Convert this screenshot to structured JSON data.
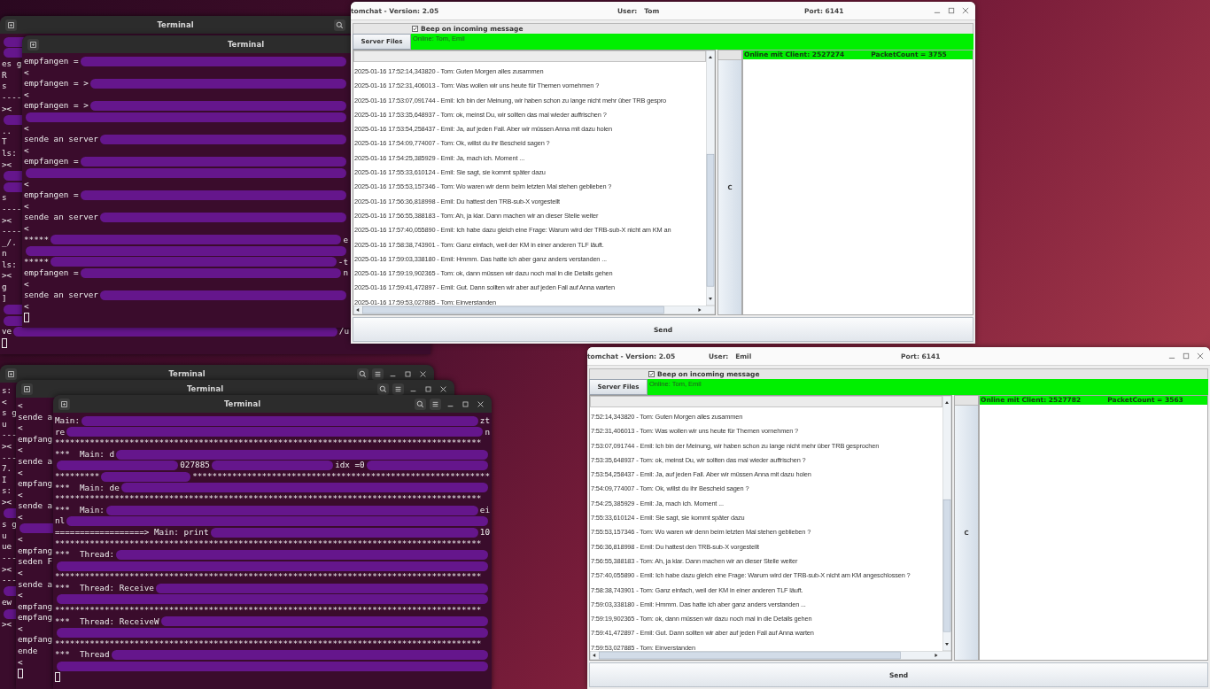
{
  "terminals": [
    {
      "title": "Terminal",
      "cursor": true,
      "lines": [
        {
          "parts": [
            {
              "kind": "scribble"
            }
          ]
        },
        {
          "parts": [
            {
              "kind": "scribble"
            }
          ]
        },
        {
          "parts": [
            {
              "kind": "text",
              "text": "es g"
            }
          ]
        },
        {
          "parts": [
            {
              "kind": "text",
              "text": "R"
            }
          ]
        },
        {
          "parts": [
            {
              "kind": "text",
              "text": "s"
            }
          ]
        },
        {
          "parts": [
            {
              "kind": "text",
              "text": "----"
            }
          ]
        },
        {
          "parts": [
            {
              "kind": "text",
              "text": "><"
            }
          ]
        },
        {
          "parts": [
            {
              "kind": "scribble"
            }
          ]
        },
        {
          "parts": [
            {
              "kind": "text",
              "text": ".."
            }
          ]
        },
        {
          "parts": [
            {
              "kind": "text",
              "text": "T"
            }
          ]
        },
        {
          "parts": [
            {
              "kind": "text",
              "text": "ls:"
            }
          ]
        },
        {
          "parts": [
            {
              "kind": "text",
              "text": "><"
            }
          ]
        },
        {
          "parts": [
            {
              "kind": "scribble"
            }
          ]
        },
        {
          "parts": [
            {
              "kind": "scribble"
            }
          ]
        },
        {
          "parts": [
            {
              "kind": "text",
              "text": "s"
            }
          ]
        },
        {
          "parts": [
            {
              "kind": "text",
              "text": "----"
            }
          ]
        },
        {
          "parts": [
            {
              "kind": "text",
              "text": "><"
            }
          ]
        },
        {
          "parts": [
            {
              "kind": "text",
              "text": "----"
            }
          ]
        },
        {
          "parts": [
            {
              "kind": "text",
              "text": "_/."
            }
          ]
        },
        {
          "parts": [
            {
              "kind": "text",
              "text": "n"
            }
          ]
        },
        {
          "parts": [
            {
              "kind": "text",
              "text": "ls:"
            }
          ]
        },
        {
          "parts": [
            {
              "kind": "text",
              "text": "><"
            }
          ]
        },
        {
          "parts": [
            {
              "kind": "text",
              "text": "g"
            }
          ]
        },
        {
          "parts": [
            {
              "kind": "text",
              "text": "]"
            }
          ]
        },
        {
          "parts": [
            {
              "kind": "scribble"
            }
          ]
        },
        {
          "parts": [
            {
              "kind": "scribble"
            }
          ]
        },
        {
          "parts": [
            {
              "kind": "text",
              "text": "ve"
            },
            {
              "kind": "scribble"
            },
            {
              "kind": "text",
              "text": "/u"
            }
          ]
        }
      ]
    },
    {
      "title": "Terminal",
      "cursor": true,
      "lines": [
        {
          "parts": [
            {
              "kind": "text",
              "text": "empfangen ="
            },
            {
              "kind": "scribble"
            }
          ]
        },
        {
          "parts": [
            {
              "kind": "text",
              "text": "<"
            }
          ]
        },
        {
          "parts": [
            {
              "kind": "text",
              "text": "empfangen = >"
            },
            {
              "kind": "scribble"
            }
          ]
        },
        {
          "parts": [
            {
              "kind": "text",
              "text": "<"
            }
          ]
        },
        {
          "parts": [
            {
              "kind": "text",
              "text": "empfangen = >"
            },
            {
              "kind": "scribble"
            }
          ]
        },
        {
          "parts": [
            {
              "kind": "scribble"
            }
          ]
        },
        {
          "parts": [
            {
              "kind": "text",
              "text": "<"
            }
          ]
        },
        {
          "parts": [
            {
              "kind": "text",
              "text": "sende an server"
            },
            {
              "kind": "scribble"
            }
          ]
        },
        {
          "parts": [
            {
              "kind": "text",
              "text": "<"
            }
          ]
        },
        {
          "parts": [
            {
              "kind": "text",
              "text": "empfangen ="
            },
            {
              "kind": "scribble"
            }
          ]
        },
        {
          "parts": [
            {
              "kind": "scribble"
            }
          ]
        },
        {
          "parts": [
            {
              "kind": "text",
              "text": "<"
            }
          ]
        },
        {
          "parts": [
            {
              "kind": "text",
              "text": "empfangen ="
            },
            {
              "kind": "scribble"
            }
          ]
        },
        {
          "parts": [
            {
              "kind": "text",
              "text": "<"
            }
          ]
        },
        {
          "parts": [
            {
              "kind": "text",
              "text": "sende an server"
            },
            {
              "kind": "scribble"
            }
          ]
        },
        {
          "parts": [
            {
              "kind": "text",
              "text": "<"
            }
          ]
        },
        {
          "parts": [
            {
              "kind": "text",
              "text": "*****"
            },
            {
              "kind": "scribble"
            },
            {
              "kind": "text",
              "text": "e"
            }
          ]
        },
        {
          "parts": [
            {
              "kind": "scribble"
            }
          ]
        },
        {
          "parts": [
            {
              "kind": "text",
              "text": "*****"
            },
            {
              "kind": "scribble"
            },
            {
              "kind": "text",
              "text": "-t"
            }
          ]
        },
        {
          "parts": [
            {
              "kind": "text",
              "text": "empfangen ="
            },
            {
              "kind": "scribble"
            },
            {
              "kind": "text",
              "text": "n"
            }
          ]
        },
        {
          "parts": [
            {
              "kind": "text",
              "text": "<"
            }
          ]
        },
        {
          "parts": [
            {
              "kind": "text",
              "text": "sende an server"
            },
            {
              "kind": "scribble"
            }
          ]
        },
        {
          "parts": [
            {
              "kind": "text",
              "text": "<"
            }
          ]
        }
      ]
    },
    {
      "title": "Terminal",
      "cursor": false,
      "lines": [
        {
          "parts": [
            {
              "kind": "text",
              "text": "s:"
            }
          ]
        },
        {
          "parts": [
            {
              "kind": "text",
              "text": "<"
            }
          ]
        },
        {
          "parts": [
            {
              "kind": "text",
              "text": "s g"
            }
          ]
        },
        {
          "parts": [
            {
              "kind": "text",
              "text": "u"
            }
          ]
        },
        {
          "parts": [
            {
              "kind": "text",
              "text": "---"
            }
          ]
        },
        {
          "parts": [
            {
              "kind": "text",
              "text": "><"
            }
          ]
        },
        {
          "parts": [
            {
              "kind": "text",
              "text": "---"
            }
          ]
        },
        {
          "parts": [
            {
              "kind": "text",
              "text": "7."
            }
          ]
        },
        {
          "parts": [
            {
              "kind": "text",
              "text": "I"
            }
          ]
        },
        {
          "parts": [
            {
              "kind": "text",
              "text": "s:"
            }
          ]
        },
        {
          "parts": [
            {
              "kind": "text",
              "text": "><"
            }
          ]
        },
        {
          "parts": [
            {
              "kind": "scribble"
            }
          ]
        },
        {
          "parts": [
            {
              "kind": "text",
              "text": "s g"
            }
          ]
        },
        {
          "parts": [
            {
              "kind": "text",
              "text": "u"
            }
          ]
        },
        {
          "parts": [
            {
              "kind": "text",
              "text": "ue"
            }
          ]
        },
        {
          "parts": [
            {
              "kind": "text",
              "text": "---"
            }
          ]
        },
        {
          "parts": [
            {
              "kind": "text",
              "text": "><"
            }
          ]
        },
        {
          "parts": [
            {
              "kind": "text",
              "text": "---"
            }
          ]
        },
        {
          "parts": [
            {
              "kind": "scribble"
            }
          ]
        },
        {
          "parts": [
            {
              "kind": "text",
              "text": "ew"
            }
          ]
        },
        {
          "parts": [
            {
              "kind": "scribble"
            }
          ]
        },
        {
          "parts": [
            {
              "kind": "text",
              "text": "><"
            }
          ]
        }
      ]
    },
    {
      "title": "Terminal",
      "cursor": true,
      "lines": [
        {
          "parts": [
            {
              "kind": "text",
              "text": "<"
            }
          ]
        },
        {
          "parts": [
            {
              "kind": "text",
              "text": "sende a"
            }
          ]
        },
        {
          "parts": [
            {
              "kind": "text",
              "text": "<"
            }
          ]
        },
        {
          "parts": [
            {
              "kind": "text",
              "text": "empfang"
            }
          ]
        },
        {
          "parts": [
            {
              "kind": "text",
              "text": "<"
            }
          ]
        },
        {
          "parts": [
            {
              "kind": "text",
              "text": "sende a"
            }
          ]
        },
        {
          "parts": [
            {
              "kind": "text",
              "text": "<"
            }
          ]
        },
        {
          "parts": [
            {
              "kind": "text",
              "text": "empfang"
            }
          ]
        },
        {
          "parts": [
            {
              "kind": "text",
              "text": "<"
            }
          ]
        },
        {
          "parts": [
            {
              "kind": "text",
              "text": "sende a"
            }
          ]
        },
        {
          "parts": [
            {
              "kind": "text",
              "text": "<"
            }
          ]
        },
        {
          "parts": [
            {
              "kind": "scribble"
            }
          ]
        },
        {
          "parts": [
            {
              "kind": "text",
              "text": "<"
            }
          ]
        },
        {
          "parts": [
            {
              "kind": "text",
              "text": "empfang"
            }
          ]
        },
        {
          "parts": [
            {
              "kind": "text",
              "text": "seden F"
            }
          ]
        },
        {
          "parts": [
            {
              "kind": "text",
              "text": "<"
            }
          ]
        },
        {
          "parts": [
            {
              "kind": "text",
              "text": "sende a"
            }
          ]
        },
        {
          "parts": [
            {
              "kind": "text",
              "text": "<"
            }
          ]
        },
        {
          "parts": [
            {
              "kind": "text",
              "text": "empfang"
            }
          ]
        },
        {
          "parts": [
            {
              "kind": "text",
              "text": "empfang"
            }
          ]
        },
        {
          "parts": [
            {
              "kind": "text",
              "text": "<"
            }
          ]
        },
        {
          "parts": [
            {
              "kind": "text",
              "text": "empfang"
            }
          ]
        },
        {
          "parts": [
            {
              "kind": "text",
              "text": "ende"
            }
          ]
        },
        {
          "parts": [
            {
              "kind": "text",
              "text": "<"
            }
          ]
        }
      ]
    },
    {
      "title": "Terminal",
      "cursor": true,
      "lines": [
        {
          "parts": [
            {
              "kind": "text",
              "text": "Main:"
            },
            {
              "kind": "scribble"
            },
            {
              "kind": "text",
              "text": "zt"
            }
          ]
        },
        {
          "parts": [
            {
              "kind": "text",
              "text": "re"
            },
            {
              "kind": "scribble"
            },
            {
              "kind": "text",
              "text": "n"
            }
          ]
        },
        {
          "parts": [
            {
              "kind": "text",
              "text": "**************************************************************************************"
            }
          ]
        },
        {
          "parts": [
            {
              "kind": "text",
              "text": "***  Main: d"
            },
            {
              "kind": "scribble"
            }
          ]
        },
        {
          "parts": [
            {
              "kind": "scribble"
            },
            {
              "kind": "text",
              "text": "027885"
            },
            {
              "kind": "scribble"
            },
            {
              "kind": "text",
              "text": "idx =0"
            },
            {
              "kind": "scribble"
            }
          ]
        },
        {
          "parts": [
            {
              "kind": "text",
              "text": "*********"
            },
            {
              "kind": "scribble"
            },
            {
              "kind": "text",
              "text": "************************************************************"
            }
          ]
        },
        {
          "parts": [
            {
              "kind": "text",
              "text": "***  Main: de"
            },
            {
              "kind": "scribble"
            }
          ]
        },
        {
          "parts": [
            {
              "kind": "text",
              "text": "**************************************************************************************"
            }
          ]
        },
        {
          "parts": [
            {
              "kind": "text",
              "text": "***  Main:"
            },
            {
              "kind": "scribble"
            },
            {
              "kind": "text",
              "text": "ei"
            }
          ]
        },
        {
          "parts": [
            {
              "kind": "text",
              "text": "nl"
            },
            {
              "kind": "scribble"
            }
          ]
        },
        {
          "parts": [
            {
              "kind": "text",
              "text": "==================> Main: print"
            },
            {
              "kind": "scribble"
            },
            {
              "kind": "text",
              "text": "10"
            }
          ]
        },
        {
          "parts": [
            {
              "kind": "text",
              "text": "**************************************************************************************"
            }
          ]
        },
        {
          "parts": [
            {
              "kind": "text",
              "text": "***  Thread:"
            },
            {
              "kind": "scribble"
            }
          ]
        },
        {
          "parts": [
            {
              "kind": "scribble"
            }
          ]
        },
        {
          "parts": [
            {
              "kind": "text",
              "text": "**************************************************************************************"
            }
          ]
        },
        {
          "parts": [
            {
              "kind": "text",
              "text": "***  Thread: Receive"
            },
            {
              "kind": "scribble"
            }
          ]
        },
        {
          "parts": [
            {
              "kind": "scribble"
            }
          ]
        },
        {
          "parts": [
            {
              "kind": "text",
              "text": "**************************************************************************************"
            }
          ]
        },
        {
          "parts": [
            {
              "kind": "text",
              "text": "***  Thread: ReceiveW"
            },
            {
              "kind": "scribble"
            }
          ]
        },
        {
          "parts": [
            {
              "kind": "scribble"
            }
          ]
        },
        {
          "parts": [
            {
              "kind": "text",
              "text": "**************************************************************************************"
            }
          ]
        },
        {
          "parts": [
            {
              "kind": "text",
              "text": "***  Thread"
            },
            {
              "kind": "scribble"
            }
          ]
        },
        {
          "parts": [
            {
              "kind": "scribble"
            }
          ]
        }
      ]
    }
  ],
  "chat_windows": [
    {
      "title": "tomchat - Version: 2.05",
      "user": "User:   Tom",
      "port": "Port: 6141",
      "beep": {
        "label": "Beep on incoming message",
        "checked": true
      },
      "server_files": "Server Files",
      "online_users": "Online: Tom, Emil",
      "clear_button": "C",
      "client_status": "Online mit Client: 2527274",
      "packet_count": "PacketCount = 3755",
      "send_button": "Send",
      "messages": [
        "2025-01-16 17:52:14,343820 - Tom: Guten Morgen alles zusammen",
        "2025-01-16 17:52:31,406013 - Tom: Was wollen wir uns heute für Themen vornehmen ?",
        "2025-01-16 17:53:07,091744 - Emil: Ich bin der Meinung, wir haben schon zu lange nicht mehr über TRB gespro",
        "2025-01-16 17:53:35,648937 - Tom: ok, meinst Du, wir sollten das mal wieder auffrischen ?",
        "2025-01-16 17:53:54,258437 - Emil: Ja, auf jeden Fall. Aber wir müssen Anna mit dazu holen",
        "2025-01-16 17:54:09,774007 - Tom: Ok, willst du ihr Bescheid sagen ?",
        "2025-01-16 17:54:25,385929 - Emil: Ja, mach ich.  Moment ...",
        "2025-01-16 17:55:33,610124 - Emil: Sie sagt, sie kommt später dazu",
        "2025-01-16 17:55:53,157346 - Tom: Wo waren wir denn beim letzten Mal stehen geblieben ?",
        "2025-01-16 17:56:36,818998 - Emil: Du hattest den TRB-sub-X vorgestellt",
        "2025-01-16 17:56:55,388183 - Tom: Ah, ja klar. Dann machen wir an dieser Stelle weiter",
        "2025-01-16 17:57:40,055890 - Emil: Ich habe dazu gleich eine Frage: Warum wird der TRB-sub-X nicht am KM an",
        "2025-01-16 17:58:38,743901 - Tom: Ganz einfach, weil der KM in einer anderen TLF läuft.",
        "2025-01-16 17:59:03,338180 - Emil: Hmmm. Das hatte ich aber ganz anders verstanden ...",
        "2025-01-16 17:59:19,902365 - Tom: ok, dann müssen wir dazu noch mal in die Details gehen",
        "2025-01-16 17:59:41,472897 - Emil: Gut. Dann sollten wir aber auf jeden Fall auf Anna warten",
        "2025-01-16 17:59:53,027885 - Tom: Einverstanden"
      ]
    },
    {
      "title": "tomchat - Version: 2.05",
      "user": "User:   Emil",
      "port": "Port: 6141",
      "beep": {
        "label": "Beep on incoming message",
        "checked": true
      },
      "server_files": "Server Files",
      "online_users": "Online: Tom, Emil",
      "clear_button": "C",
      "client_status": "Online mit Client: 2527782",
      "packet_count": "PacketCount = 3563",
      "send_button": "Send",
      "messages": [
        "7:52:14,343820 - Tom: Guten Morgen alles zusammen",
        "7:52:31,406013 - Tom: Was wollen wir uns heute für Themen vornehmen ?",
        "7:53:07,091744 - Emil: Ich bin der Meinung, wir haben schon zu lange nicht mehr über TRB gesprochen",
        "7:53:35,648937 - Tom: ok, meinst Du, wir sollten das mal wieder auffrischen ?",
        "7:53:54,258437 - Emil: Ja, auf jeden Fall. Aber wir müssen Anna mit dazu holen",
        "7:54:09,774007 - Tom: Ok, willst du ihr Bescheid sagen ?",
        "7:54:25,385929 - Emil: Ja, mach ich.  Moment ...",
        "7:55:33,610124 - Emil: Sie sagt, sie kommt später dazu",
        "7:55:53,157346 - Tom: Wo waren wir denn beim letzten Mal stehen geblieben ?",
        "7:56:36,818998 - Emil: Du hattest den TRB-sub-X vorgestellt",
        "7:56:55,388183 - Tom: Ah, ja klar. Dann machen wir an dieser Stelle weiter",
        "7:57:40,055890 - Emil: Ich habe dazu gleich eine Frage: Warum wird der TRB-sub-X nicht am KM angeschlossen ?",
        "7:58:38,743901 - Tom: Ganz einfach, weil der KM in einer anderen TLF läuft.",
        "7:59:03,338180 - Emil: Hmmm. Das hatte ich aber ganz anders verstanden ...",
        "7:59:19,902365 - Tom: ok, dann müssen wir dazu noch mal in die Details gehen",
        "7:59:41,472897 - Emil: Gut. Dann sollten wir aber auf jeden Fall auf Anna warten",
        "7:59:53,027885 - Tom: Einverstanden"
      ]
    }
  ]
}
